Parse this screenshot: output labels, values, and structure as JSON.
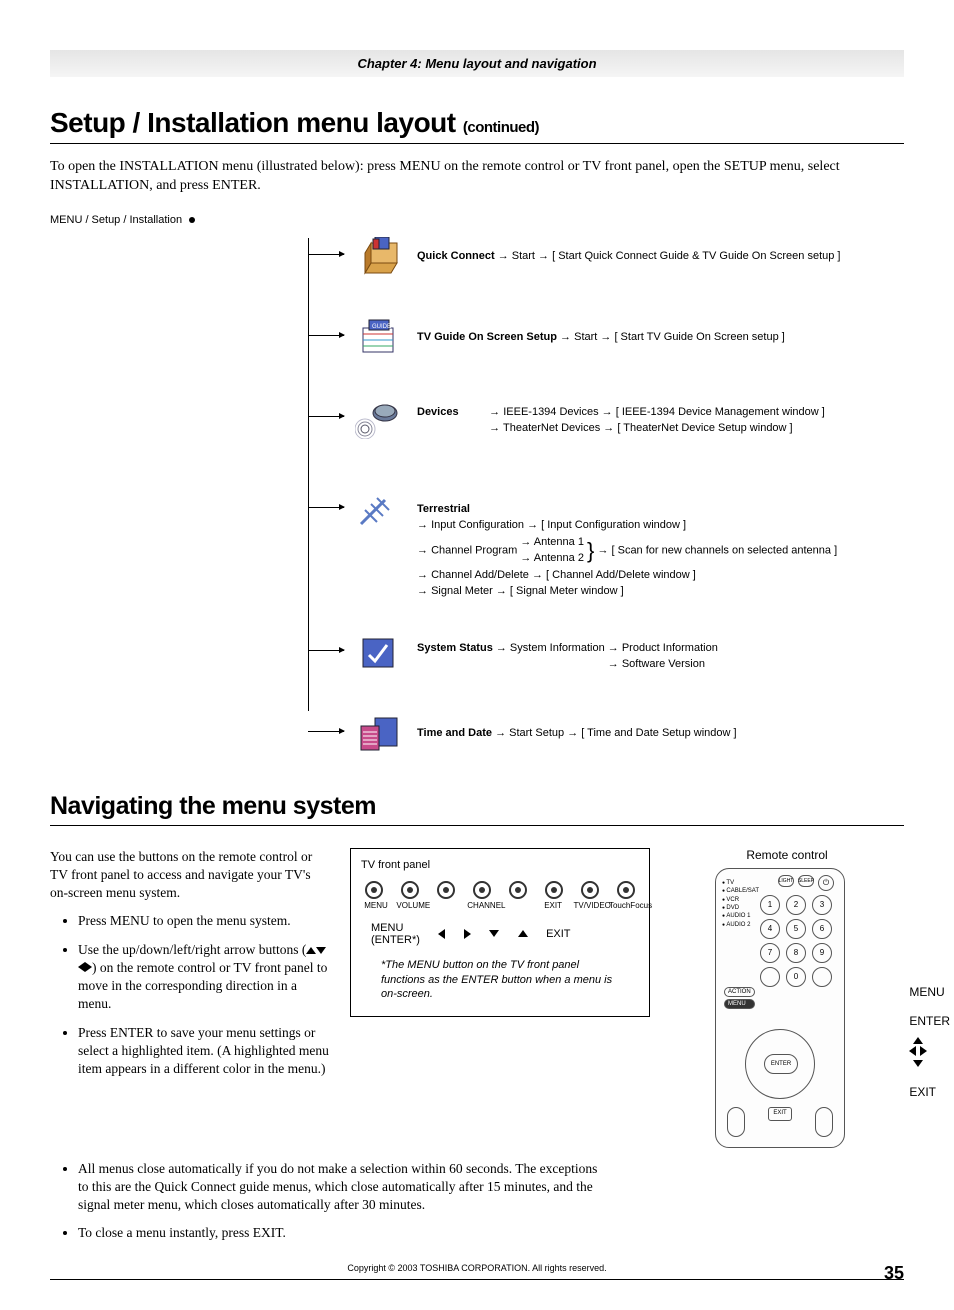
{
  "chapter_bar": "Chapter 4: Menu layout and navigation",
  "h1_main": "Setup / Installation menu layout ",
  "h1_sub": "(continued)",
  "intro": "To open the INSTALLATION menu (illustrated below): press MENU on the remote control or TV front panel, open the SETUP menu, select INSTALLATION, and press ENTER.",
  "breadcrumb": "MENU / Setup / Installation",
  "menu": {
    "quick_connect": {
      "label": "Quick Connect",
      "path": "→  Start  →   [ Start Quick Connect Guide & TV Guide On Screen setup ]"
    },
    "tv_guide": {
      "label": "TV Guide On Screen Setup",
      "path": "→  Start →   [ Start TV Guide On Screen setup ]"
    },
    "devices": {
      "label": "Devices",
      "line1": "IEEE-1394 Devices →   [ IEEE-1394 Device Management window ]",
      "line2": "TheaterNet Devices  →   [ TheaterNet Device Setup window ]"
    },
    "terrestrial": {
      "label": "Terrestrial",
      "line1": "Input Configuration  →  [ Input Configuration window ]",
      "line2a": "Channel Program",
      "line2b": "Antenna 1",
      "line2c": "Antenna 2",
      "line2d": "→ [ Scan for new channels on selected antenna ]",
      "line3": "Channel Add/Delete  →  [ Channel Add/Delete window ]",
      "line4": "Signal Meter  →   [ Signal Meter window ]"
    },
    "system_status": {
      "label": "System Status",
      "path1": "→ System Information",
      "sub1": "Product Information",
      "sub2": "Software Version"
    },
    "time_date": {
      "label": "Time and Date",
      "path": "→ Start Setup →   [ Time and Date Setup window ]"
    }
  },
  "h2": "Navigating the menu system",
  "nav_intro": "You can use the buttons on the remote control or TV front panel to access and navigate your TV's on-screen menu system.",
  "bullets": {
    "b1": "Press MENU to open the menu system.",
    "b2a": "Use the up/down/left/right arrow buttons (",
    "b2b": ") on the remote control or TV front panel to move in the corresponding direction in a menu.",
    "b3": "Press ENTER to save your menu settings or select a highlighted item. (A highlighted menu item appears in a different color in the menu.)",
    "b4": "All menus close automatically if you do not make a selection within 60 seconds. The exceptions to this are the Quick Connect guide menus, which close automatically after 15 minutes, and the signal meter menu, which closes automatically after 30 minutes.",
    "b5": "To close a menu instantly, press EXIT."
  },
  "panel": {
    "title": "TV front panel",
    "labels": [
      "MENU",
      "VOLUME",
      "",
      "CHANNEL",
      "",
      "EXIT",
      "TV/VIDEO",
      "TouchFocus"
    ],
    "map_menu": "MENU",
    "map_enter": "(ENTER*)",
    "map_exit": "EXIT",
    "note": "*The MENU button on the TV front panel functions as the ENTER button when a menu is on-screen."
  },
  "remote": {
    "title": "Remote control",
    "callouts": [
      "MENU",
      "ENTER",
      "",
      "EXIT"
    ],
    "side": [
      "TV",
      "CABLE/SAT",
      "VCR",
      "DVD",
      "AUDIO 1",
      "AUDIO 2"
    ],
    "nums": [
      "1",
      "2",
      "3",
      "4",
      "5",
      "6",
      "7",
      "8",
      "9",
      "",
      "0",
      ""
    ],
    "top_small": [
      "LIGHT",
      "SLEEP",
      "⏻"
    ],
    "enter_label": "ENTER"
  },
  "footer": "Copyright © 2003 TOSHIBA CORPORATION. All rights reserved.",
  "page_num": "35"
}
